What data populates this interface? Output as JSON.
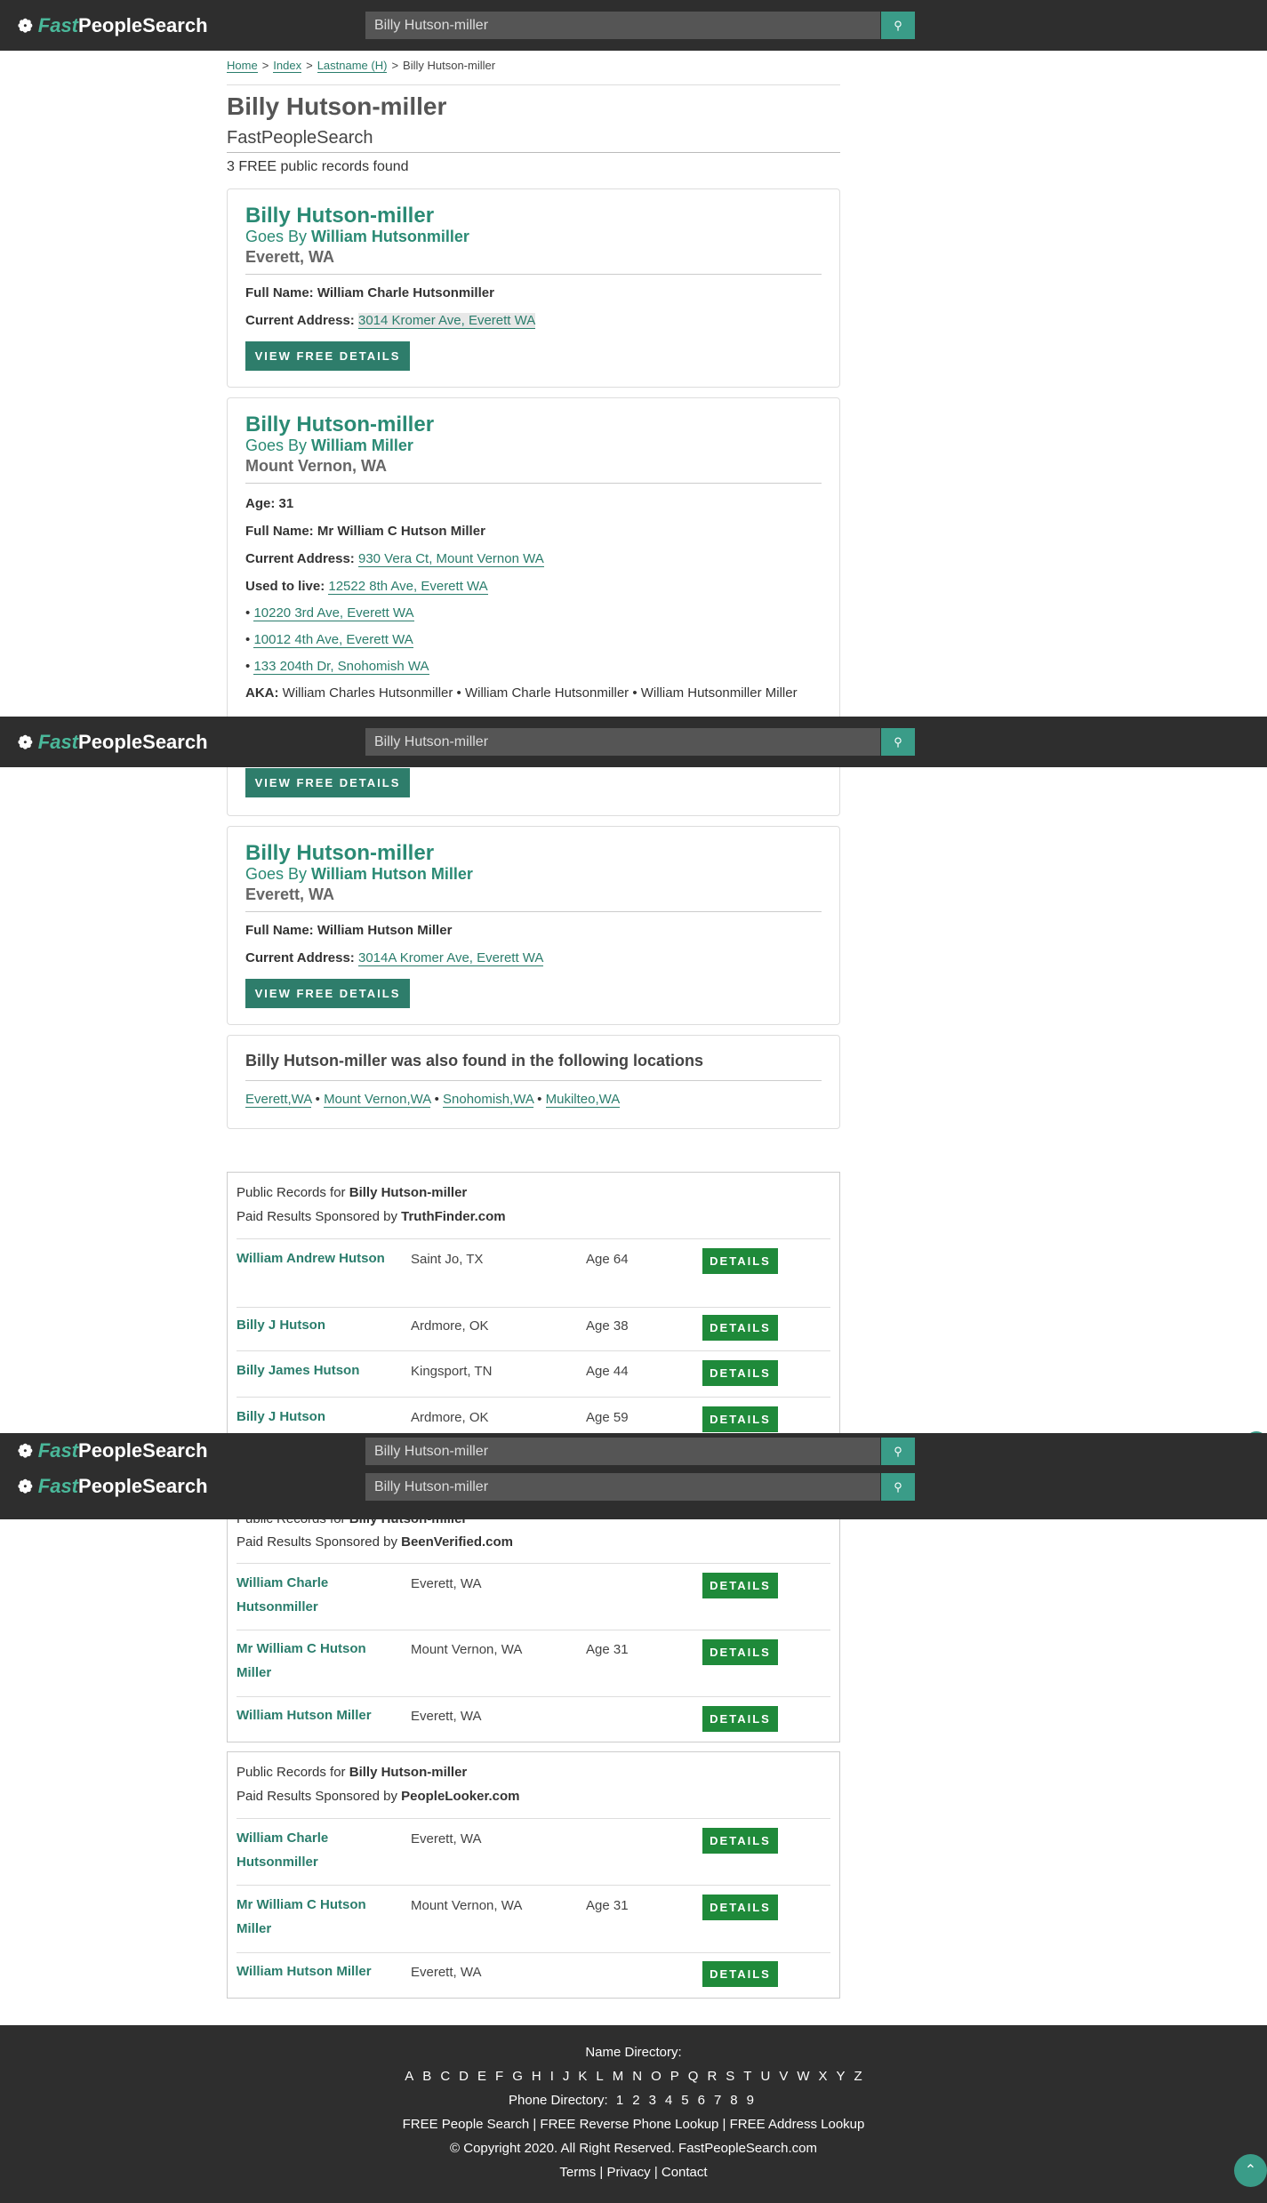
{
  "header": {
    "logo_fast": "Fast",
    "logo_people": "PeopleSearch",
    "search_value": "Billy Hutson-miller"
  },
  "breadcrumb": [
    "Home",
    "Index",
    "Lastname (H)",
    "Billy Hutson-miller"
  ],
  "page": {
    "title": "Billy Hutson-miller",
    "subtitle": "FastPeopleSearch",
    "records_found": "3 FREE public records found"
  },
  "cards": [
    {
      "name": "Billy Hutson-miller",
      "goes_prefix": "Goes By",
      "goes_by": "William Hutsonmiller",
      "location": "Everett, WA",
      "full_name_label": "Full Name:",
      "full_name": "William Charle Hutsonmiller",
      "address_label": "Current Address:",
      "address": "3014 Kromer Ave, Everett WA",
      "button": "VIEW FREE DETAILS"
    },
    {
      "name": "Billy Hutson-miller",
      "goes_prefix": "Goes By",
      "goes_by": "William Miller",
      "location": "Mount Vernon, WA",
      "age_label": "Age:",
      "age": "31",
      "full_name_label": "Full Name:",
      "full_name": "Mr William C Hutson Miller",
      "address_label": "Current Address:",
      "address": "930 Vera Ct, Mount Vernon WA",
      "used_label": "Used to live:",
      "used_first": "12522 8th Ave, Everett WA",
      "past": [
        "10220 3rd Ave, Everett WA",
        "10012 4th Ave, Everett WA",
        "133 204th Dr, Snohomish WA"
      ],
      "aka_label": "AKA:",
      "aka": "William Charles Hutsonmiller • William Charle Hutsonmiller • William Hutsonmiller Miller",
      "button": "VIEW FREE DETAILS"
    },
    {
      "name": "Billy Hutson-miller",
      "goes_prefix": "Goes By",
      "goes_by": "William Hutson Miller",
      "location": "Everett, WA",
      "full_name_label": "Full Name:",
      "full_name": "William Hutson Miller",
      "address_label": "Current Address:",
      "address": "3014A Kromer Ave, Everett WA",
      "button": "VIEW FREE DETAILS"
    }
  ],
  "also_found": {
    "title": "Billy Hutson-miller was also found in the following locations",
    "locations": [
      "Everett,WA",
      "Mount Vernon,WA",
      "Snohomish,WA",
      "Mukilteo,WA"
    ]
  },
  "sponsored": [
    {
      "header_prefix": "Public Records for",
      "header_name": "Billy Hutson-miller",
      "sponsor_prefix": "Paid Results Sponsored by",
      "sponsor": "TruthFinder.com",
      "rows": [
        {
          "name": "William Andrew Hutson",
          "location": "Saint Jo, TX",
          "age": "Age 64",
          "button": "DETAILS"
        },
        {
          "name": "Billy J Hutson",
          "location": "Ardmore, OK",
          "age": "Age 38",
          "button": "DETAILS"
        },
        {
          "name": "Billy James Hutson",
          "location": "Kingsport, TN",
          "age": "Age 44",
          "button": "DETAILS"
        },
        {
          "name": "Billy J Hutson",
          "location": "Ardmore, OK",
          "age": "Age 59",
          "button": "DETAILS"
        }
      ]
    },
    {
      "header_prefix": "Public Records for",
      "header_name": "Billy Hutson-miller",
      "sponsor_prefix": "Paid Results Sponsored by",
      "sponsor": "BeenVerified.com",
      "rows": [
        {
          "name": "William Charle Hutsonmiller",
          "location": "Everett, WA",
          "age": "",
          "button": "DETAILS"
        },
        {
          "name": "Mr William C Hutson Miller",
          "location": "Mount Vernon, WA",
          "age": "Age 31",
          "button": "DETAILS"
        },
        {
          "name": "William Hutson Miller",
          "location": "Everett, WA",
          "age": "",
          "button": "DETAILS"
        }
      ]
    },
    {
      "header_prefix": "Public Records for",
      "header_name": "Billy Hutson-miller",
      "sponsor_prefix": "Paid Results Sponsored by",
      "sponsor": "PeopleLooker.com",
      "rows": [
        {
          "name": "William Charle Hutsonmiller",
          "location": "Everett, WA",
          "age": "",
          "button": "DETAILS"
        },
        {
          "name": "Mr William C Hutson Miller",
          "location": "Mount Vernon, WA",
          "age": "Age 31",
          "button": "DETAILS"
        },
        {
          "name": "William Hutson Miller",
          "location": "Everett, WA",
          "age": "",
          "button": "DETAILS"
        }
      ]
    }
  ],
  "footer": {
    "name_directory": "Name Directory:",
    "letters": [
      "A",
      "B",
      "C",
      "D",
      "E",
      "F",
      "G",
      "H",
      "I",
      "J",
      "K",
      "L",
      "M",
      "N",
      "O",
      "P",
      "Q",
      "R",
      "S",
      "T",
      "U",
      "V",
      "W",
      "X",
      "Y",
      "Z"
    ],
    "phone_directory": "Phone Directory:",
    "digits": [
      "1",
      "2",
      "3",
      "4",
      "5",
      "6",
      "7",
      "8",
      "9"
    ],
    "links1": "FREE People Search | FREE Reverse Phone Lookup | FREE Address Lookup",
    "copyright": "© Copyright 2020. All Right Reserved. FastPeopleSearch.com",
    "links2": "Terms | Privacy | Contact"
  },
  "colors": {
    "header_bg": "#2e2e2e",
    "accent": "#2a8a74",
    "button": "#2e7d6b",
    "details_button": "#1f8a3a"
  },
  "icons": {
    "logo": "paw-prints-icon",
    "search": "search-icon",
    "to_top": "chevron-up-icon"
  }
}
